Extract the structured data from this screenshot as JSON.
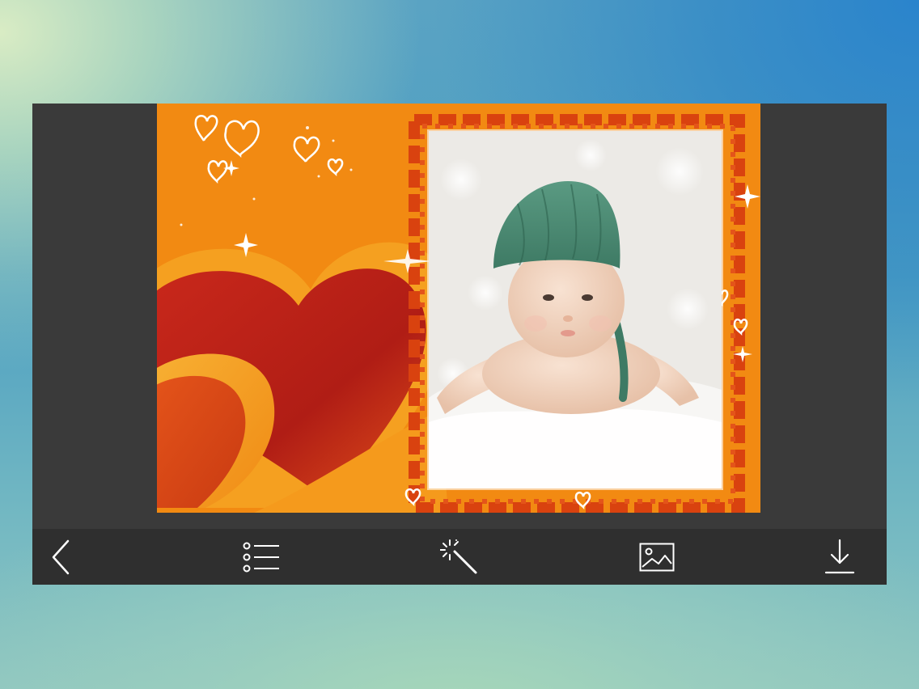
{
  "app": {
    "screen": "frame-editor"
  },
  "canvas": {
    "theme": "orange hearts frame",
    "colors": {
      "background": "#f28a12",
      "heart_dark": "#c4261a",
      "heart_light": "#f5a623",
      "frame_border": "#d9420f",
      "sparkle": "#ffffff"
    }
  },
  "photo": {
    "subject_icon": "baby-photo"
  },
  "toolbar": {
    "items": [
      {
        "icon": "back-chevron-icon"
      },
      {
        "icon": "list-icon"
      },
      {
        "icon": "magic-wand-icon"
      },
      {
        "icon": "image-icon"
      },
      {
        "icon": "download-icon"
      }
    ],
    "icon_color": "#ffffff",
    "background": "#2f2f2f"
  }
}
